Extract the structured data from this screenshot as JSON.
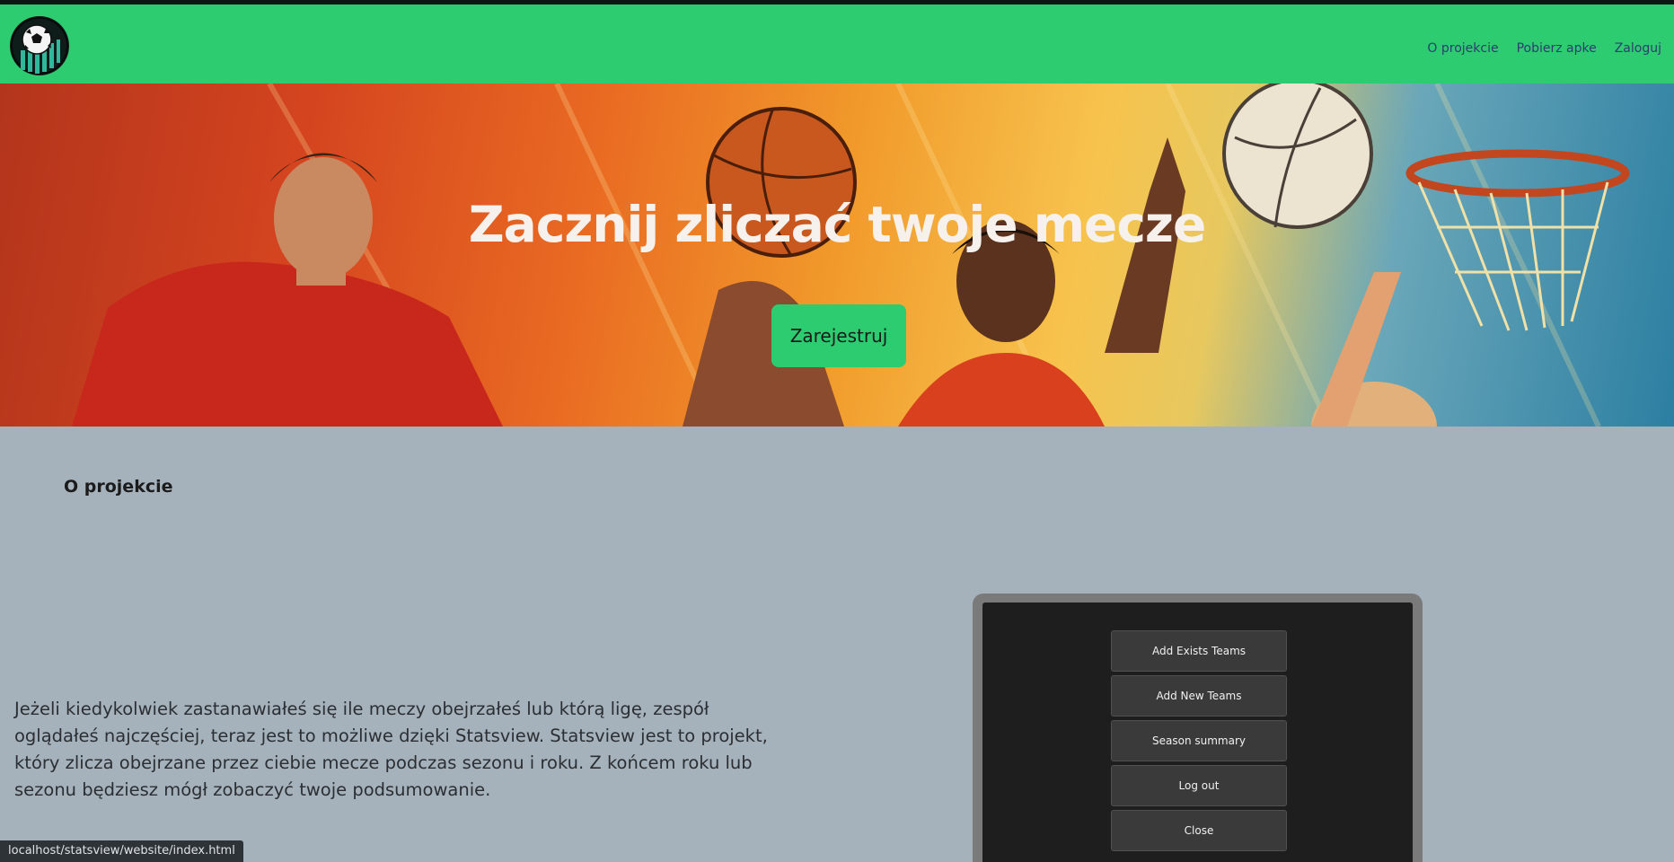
{
  "header": {
    "logo_icon": "soccer-ball-logo",
    "nav": [
      {
        "label": "O projekcie"
      },
      {
        "label": "Pobierz apke"
      },
      {
        "label": "Zaloguj"
      }
    ]
  },
  "hero": {
    "title": "Zacznij zliczać twoje mecze",
    "cta_label": "Zarejestruj"
  },
  "about": {
    "heading": "O projekcie",
    "text": "Jeżeli kiedykolwiek zastanawiałeś się ile meczy obejrzałeś lub którą ligę, zespół oglądałeś najczęściej, teraz jest to możliwe dzięki Statsview. Statsview jest to projekt, który zlicza obejrzane przez ciebie mecze podczas sezonu i roku. Z końcem roku lub sezonu będziesz mógł zobaczyć twoje podsumowanie."
  },
  "app_preview": {
    "buttons": [
      {
        "label": "Add Exists Teams"
      },
      {
        "label": "Add New Teams"
      },
      {
        "label": "Season summary"
      },
      {
        "label": "Log out"
      },
      {
        "label": "Close"
      }
    ]
  },
  "status_bar": {
    "url": "localhost/statsview/website/index.html"
  },
  "colors": {
    "accent": "#2ecc71",
    "page_background": "#a5b2bb",
    "nav_link": "#2d3e6e"
  }
}
